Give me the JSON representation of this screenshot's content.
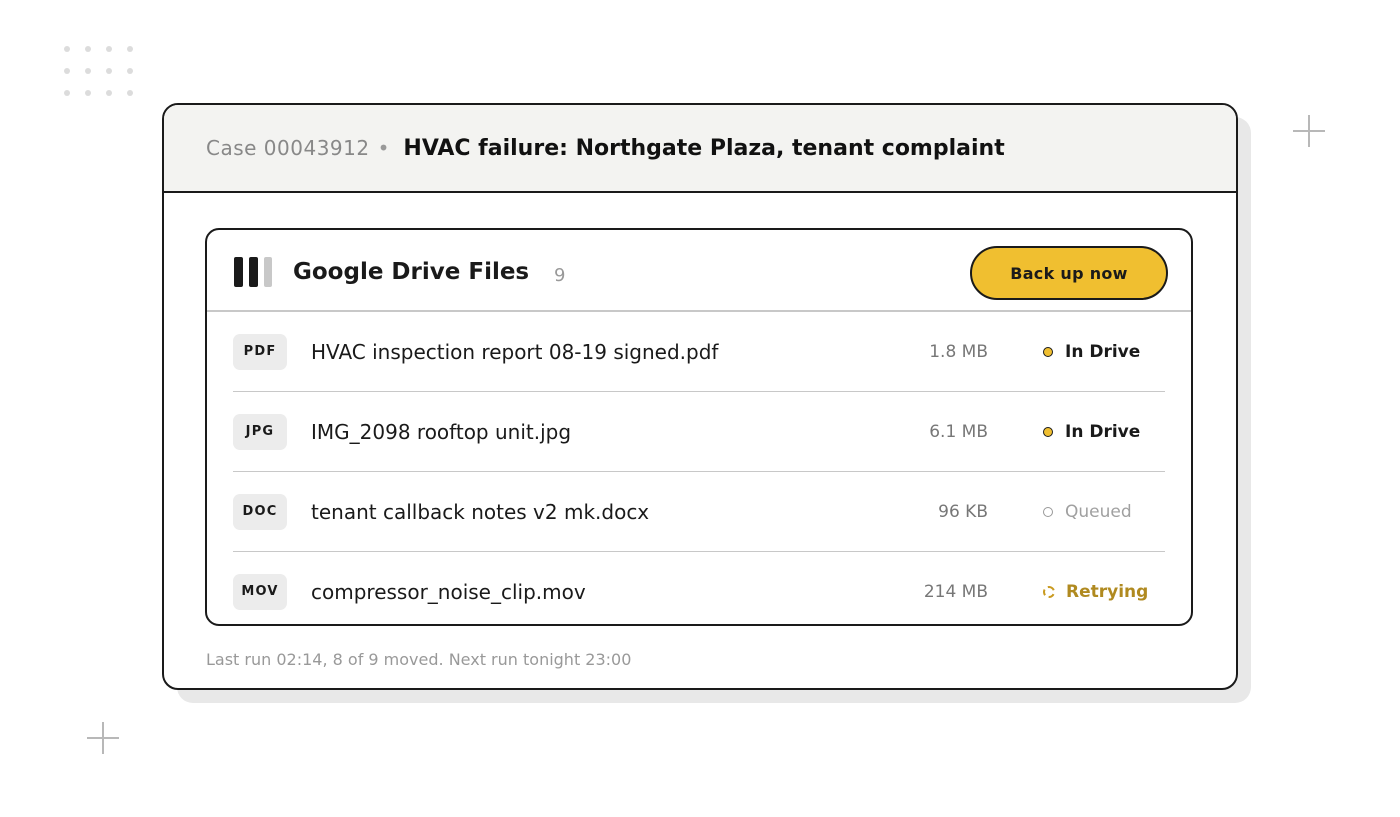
{
  "case": {
    "id": "Case 00043912",
    "separator": "•",
    "title": "HVAC failure: Northgate Plaza, tenant complaint"
  },
  "panel": {
    "title": "Google Drive Files",
    "count": "9",
    "backup_label": "Back up now",
    "icon": "google-drive-icon"
  },
  "files": [
    {
      "type": "PDF",
      "name": "HVAC inspection report 08-19 signed.pdf",
      "size": "1.8 MB",
      "status": "In Drive"
    },
    {
      "type": "JPG",
      "name": "IMG_2098 rooftop unit.jpg",
      "size": "6.1 MB",
      "status": "In Drive"
    },
    {
      "type": "DOC",
      "name": "tenant callback notes v2 mk.docx",
      "size": "96 KB",
      "status": "Queued"
    },
    {
      "type": "MOV",
      "name": "compressor_noise_clip.mov",
      "size": "214 MB",
      "status": "Retrying"
    }
  ],
  "footer": {
    "text": "Last run 02:14, 8 of 9 moved. Next run tonight 23:00"
  },
  "colors": {
    "accent": "#f0bf30",
    "border": "#1a1a1a",
    "retrying": "#b08a20",
    "muted": "#999999"
  }
}
